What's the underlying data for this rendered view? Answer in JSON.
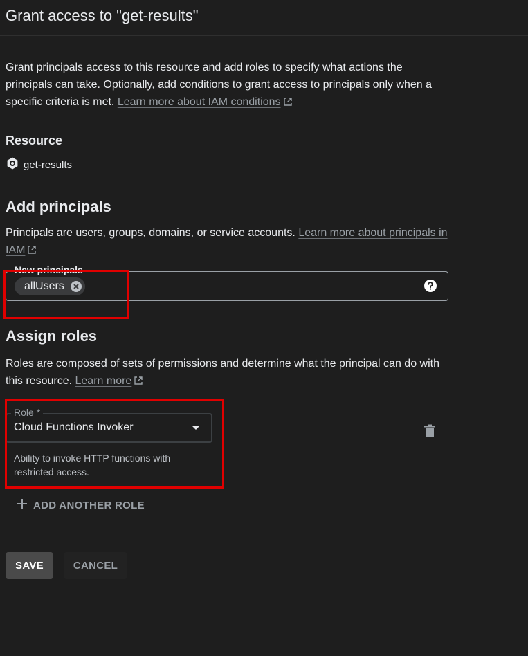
{
  "header": {
    "title": "Grant access to \"get-results\""
  },
  "intro": {
    "text": "Grant principals access to this resource and add roles to specify what actions the principals can take. Optionally, add conditions to grant access to principals only when a specific criteria is met.",
    "link": "Learn more about IAM conditions"
  },
  "resource": {
    "title": "Resource",
    "name": "get-results",
    "icon": "cloud-functions-icon"
  },
  "principals": {
    "title": "Add principals",
    "description": "Principals are users, groups, domains, or service accounts.",
    "link": "Learn more about principals in IAM",
    "field_label": "New principals",
    "chips": [
      "allUsers"
    ],
    "help_icon": "help-icon"
  },
  "roles": {
    "title": "Assign roles",
    "description": "Roles are composed of sets of permissions and determine what the principal can do with this resource.",
    "link": "Learn more",
    "role_label": "Role *",
    "role_value": "Cloud Functions Invoker",
    "role_help": "Ability to invoke HTTP functions with restricted access.",
    "delete_icon": "trash-icon",
    "add_another": "ADD ANOTHER ROLE"
  },
  "actions": {
    "save": "SAVE",
    "cancel": "CANCEL"
  },
  "colors": {
    "background": "#1e1e1e",
    "text": "#e8eaed",
    "muted": "#9aa0a6",
    "highlight": "#e00000",
    "save_bg": "#4a4a4a"
  }
}
